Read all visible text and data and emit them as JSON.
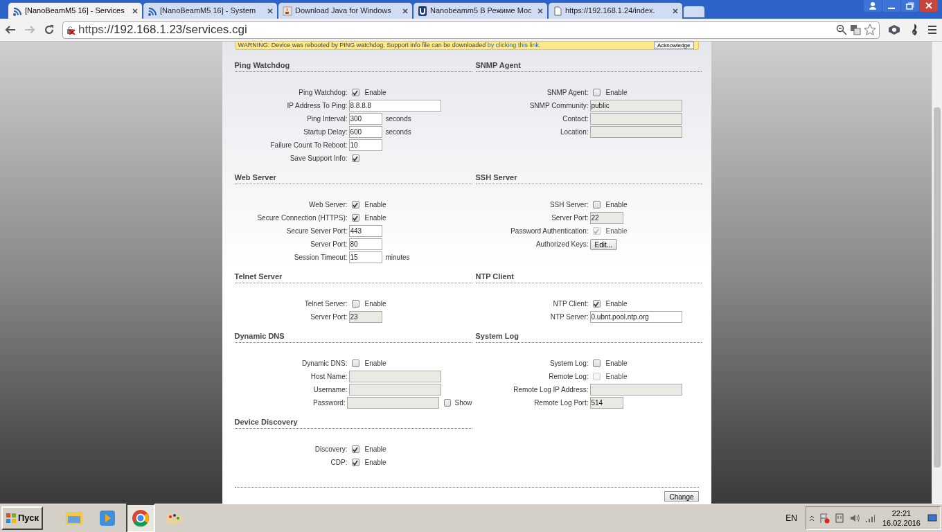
{
  "browser": {
    "tabs": [
      {
        "title": "[NanoBeamM5 16] - Services",
        "selected": true
      },
      {
        "title": "[NanoBeamM5 16] - System",
        "selected": false
      },
      {
        "title": "Download Java for Windows",
        "selected": false
      },
      {
        "title": "Nanobeamm5 В Режиме Мос",
        "selected": false
      },
      {
        "title": "https://192.168.1.24/index.",
        "selected": false
      }
    ],
    "address": {
      "scheme": "https",
      "rest": "://192.168.1.23/services.cgi"
    }
  },
  "warning": {
    "text": "WARNING: Device was rebooted by PING watchdog. Support info file can be downloaded ",
    "link": "by clicking this link",
    "end": ".",
    "button": "Acknowledge"
  },
  "section_rows": [
    {
      "left": {
        "title": "Ping Watchdog",
        "rows": [
          {
            "label": "Ping Watchdog:",
            "kind": "checkbox",
            "checked": true,
            "disabled": false,
            "text": "Enable"
          },
          {
            "label": "IP Address To Ping:",
            "kind": "text",
            "value": "8.8.8.8",
            "disabled": false
          },
          {
            "label": "Ping Interval:",
            "kind": "number",
            "value": "300",
            "suffix": "seconds",
            "disabled": false
          },
          {
            "label": "Startup Delay:",
            "kind": "number",
            "value": "600",
            "suffix": "seconds",
            "disabled": false
          },
          {
            "label": "Failure Count To Reboot:",
            "kind": "number",
            "value": "10",
            "disabled": false
          },
          {
            "label": "Save Support Info:",
            "kind": "checkbox",
            "checked": true,
            "disabled": false
          }
        ]
      },
      "right": {
        "title": "SNMP Agent",
        "rows": [
          {
            "label": "SNMP Agent:",
            "kind": "checkbox",
            "checked": false,
            "disabled": false,
            "text": "Enable"
          },
          {
            "label": "SNMP Community:",
            "kind": "text",
            "value": "public",
            "disabled": true
          },
          {
            "label": "Contact:",
            "kind": "text",
            "disabled": true
          },
          {
            "label": "Location:",
            "kind": "text",
            "disabled": true
          }
        ]
      }
    },
    {
      "left": {
        "title": "Web Server",
        "rows": [
          {
            "label": "Web Server:",
            "kind": "checkbox",
            "checked": true,
            "disabled": false,
            "text": "Enable"
          },
          {
            "label": "Secure Connection (HTTPS):",
            "kind": "checkbox",
            "checked": true,
            "disabled": false,
            "text": "Enable"
          },
          {
            "label": "Secure Server Port:",
            "kind": "number",
            "value": "443",
            "disabled": false
          },
          {
            "label": "Server Port:",
            "kind": "number",
            "value": "80",
            "disabled": false
          },
          {
            "label": "Session Timeout:",
            "kind": "number",
            "value": "15",
            "suffix": "minutes",
            "disabled": false
          }
        ]
      },
      "right": {
        "title": "SSH Server",
        "rows": [
          {
            "label": "SSH Server:",
            "kind": "checkbox",
            "checked": false,
            "disabled": false,
            "text": "Enable"
          },
          {
            "label": "Server Port:",
            "kind": "number",
            "value": "22",
            "disabled": true
          },
          {
            "label": "Password Authentication:",
            "kind": "checkbox",
            "checked": true,
            "disabled": true,
            "text": "Enable"
          },
          {
            "label": "Authorized Keys:",
            "kind": "button",
            "text": "Edit..."
          }
        ]
      }
    },
    {
      "left": {
        "title": "Telnet Server",
        "rows": [
          {
            "label": "Telnet Server:",
            "kind": "checkbox",
            "checked": false,
            "disabled": false,
            "text": "Enable"
          },
          {
            "label": "Server Port:",
            "kind": "number",
            "value": "23",
            "disabled": true
          }
        ]
      },
      "right": {
        "title": "NTP Client",
        "rows": [
          {
            "label": "NTP Client:",
            "kind": "checkbox",
            "checked": true,
            "disabled": false,
            "text": "Enable"
          },
          {
            "label": "NTP Server:",
            "kind": "text",
            "value": "0.ubnt.pool.ntp.org",
            "disabled": false
          }
        ]
      }
    },
    {
      "left": {
        "title": "Dynamic DNS",
        "rows": [
          {
            "label": "Dynamic DNS:",
            "kind": "checkbox",
            "checked": false,
            "disabled": false,
            "text": "Enable"
          },
          {
            "label": "Host Name:",
            "kind": "text",
            "disabled": true
          },
          {
            "label": "Username:",
            "kind": "text",
            "disabled": true
          },
          {
            "label": "Password:",
            "kind": "text",
            "disabled": true,
            "show": {
              "text": "Show",
              "checked": false
            }
          }
        ]
      },
      "right": {
        "title": "System Log",
        "rows": [
          {
            "label": "System Log:",
            "kind": "checkbox",
            "checked": false,
            "disabled": false,
            "text": "Enable"
          },
          {
            "label": "Remote Log:",
            "kind": "checkbox",
            "checked": false,
            "disabled": true,
            "text": "Enable"
          },
          {
            "label": "Remote Log IP Address:",
            "kind": "text",
            "disabled": true
          },
          {
            "label": "Remote Log Port:",
            "kind": "number",
            "value": "514",
            "disabled": true
          }
        ]
      }
    },
    {
      "left": {
        "title": "Device Discovery",
        "rows": [
          {
            "label": "Discovery:",
            "kind": "checkbox",
            "checked": true,
            "disabled": false,
            "text": "Enable"
          },
          {
            "label": "CDP:",
            "kind": "checkbox",
            "checked": true,
            "disabled": false,
            "text": "Enable"
          }
        ]
      }
    }
  ],
  "change_button": "Change",
  "taskbar": {
    "start": "Пуск",
    "language": "EN",
    "time": "22:21",
    "date": "16.02.2016"
  }
}
